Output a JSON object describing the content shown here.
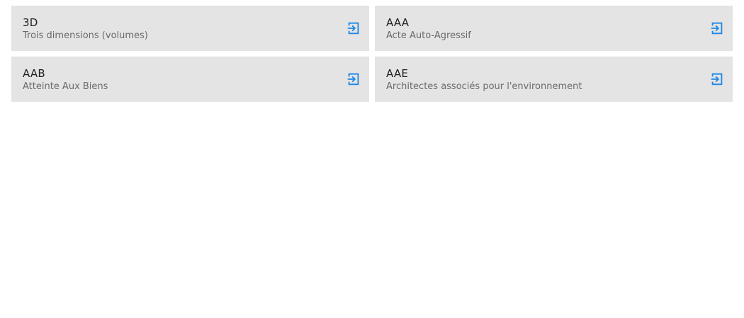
{
  "icon_color": "#1e88e5",
  "card_background": "#e4e4e4",
  "items": [
    {
      "abbr": "3D",
      "desc": "Trois dimensions (volumes)",
      "icon": "login-icon"
    },
    {
      "abbr": "AAA",
      "desc": "Acte Auto-Agressif",
      "icon": "login-icon"
    },
    {
      "abbr": "AAB",
      "desc": "Atteinte Aux Biens",
      "icon": "login-icon"
    },
    {
      "abbr": "AAE",
      "desc": "Architectes associés pour l'environnement",
      "icon": "login-icon"
    }
  ]
}
